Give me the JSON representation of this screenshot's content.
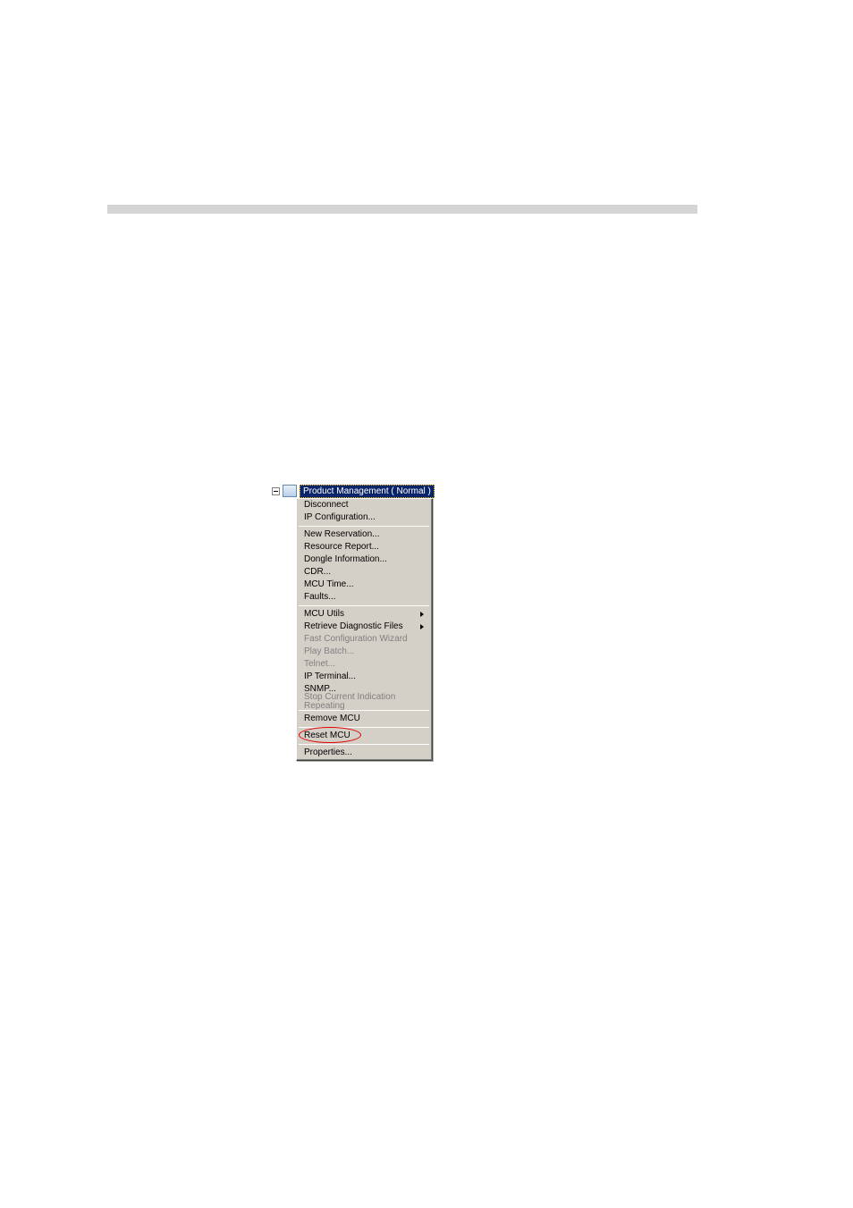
{
  "tree": {
    "label": "Product Management   ( Normal )"
  },
  "menu": {
    "disconnect": "Disconnect",
    "ipConfiguration": "IP Configuration...",
    "newReservation": "New Reservation...",
    "resourceReport": "Resource Report...",
    "dongleInformation": "Dongle Information...",
    "cdr": "CDR...",
    "mcuTime": "MCU Time...",
    "faults": "Faults...",
    "mcuUtils": "MCU Utils",
    "retrieveDiagnosticFiles": "Retrieve Diagnostic Files",
    "fastConfigurationWizard": "Fast Configuration Wizard",
    "playBatch": "Play Batch...",
    "telnet": "Telnet...",
    "ipTerminal": "IP Terminal...",
    "snmp": "SNMP...",
    "stopCurrentIndication": "Stop Current Indication Repeating",
    "removeMcu": "Remove MCU",
    "resetMcu": "Reset MCU",
    "properties": "Properties..."
  }
}
